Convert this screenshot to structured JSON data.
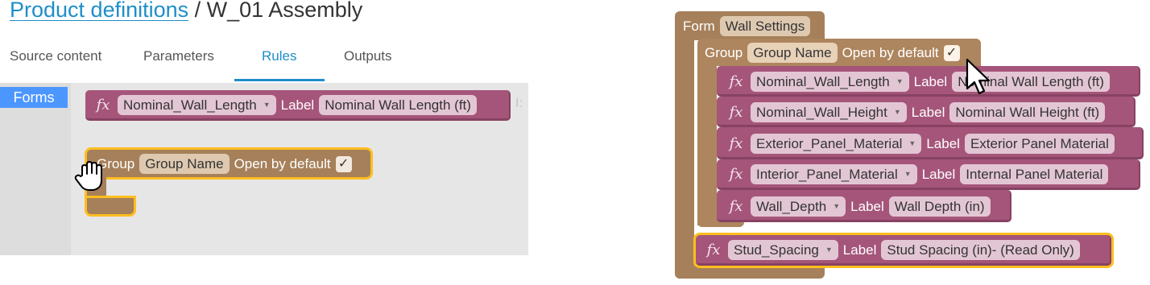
{
  "header": {
    "breadcrumb_link": "Product definitions",
    "breadcrumb_sep": " / ",
    "breadcrumb_current": "W_01 Assembly"
  },
  "tabs": [
    {
      "label": "Source content",
      "active": false
    },
    {
      "label": "Parameters",
      "active": false
    },
    {
      "label": "Rules",
      "active": true
    },
    {
      "label": "Outputs",
      "active": false
    }
  ],
  "toolbox": {
    "category": "Forms"
  },
  "left_canvas": {
    "param_block": {
      "fx": "𝑓𝑥",
      "parameter": "Nominal_Wall_Length",
      "label_kw": "Label",
      "label_value": "Nominal Wall Length (ft)"
    },
    "group_block": {
      "keyword": "Group",
      "name": "Group Name",
      "open_kw": "Open by default",
      "checked": "✓"
    }
  },
  "right_canvas": {
    "form": {
      "keyword": "Form",
      "name": "Wall Settings"
    },
    "group": {
      "keyword": "Group",
      "name": "Group Name",
      "open_kw": "Open by default",
      "checked": "✓"
    },
    "fx": "𝑓𝑥",
    "label_kw": "Label",
    "rows": [
      {
        "parameter": "Nominal_Wall_Length",
        "label": "Nominal Wall Length (ft)"
      },
      {
        "parameter": "Nominal_Wall_Height",
        "label": "Nominal Wall Height (ft)"
      },
      {
        "parameter": "Exterior_Panel_Material",
        "label": "Exterior Panel Material"
      },
      {
        "parameter": "Interior_Panel_Material",
        "label": "Internal Panel Material"
      },
      {
        "parameter": "Wall_Depth",
        "label": "Wall Depth (in)"
      }
    ],
    "stud_row": {
      "parameter": "Stud_Spacing",
      "label": "Stud Spacing (in)- (Read Only)"
    }
  },
  "colors": {
    "accent": "#1e8ec9",
    "param_block": "#a5557a",
    "form_block": "#a6805a",
    "highlight": "#fdbe20",
    "toolbox_category": "#4c97ff"
  }
}
